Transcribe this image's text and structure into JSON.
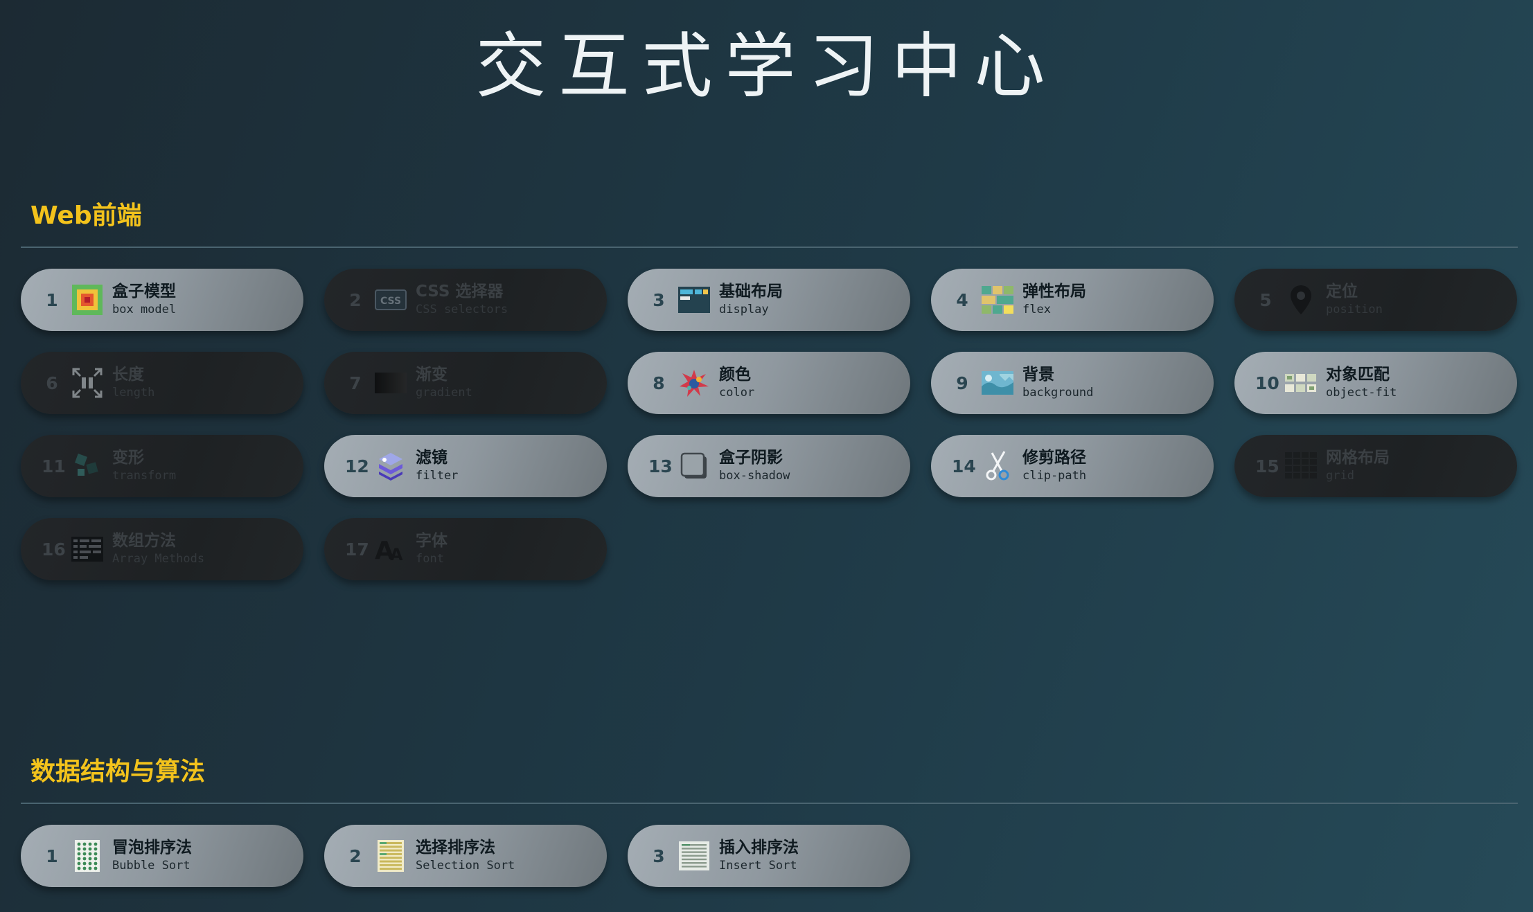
{
  "page": {
    "title": "交互式学习中心"
  },
  "sections": [
    {
      "title": "Web前端",
      "cards": [
        {
          "num": "1",
          "title": "盒子模型",
          "sub": "box model",
          "icon": "box-model-icon",
          "active": true
        },
        {
          "num": "2",
          "title": "CSS 选择器",
          "sub": "CSS selectors",
          "icon": "css-icon",
          "active": false
        },
        {
          "num": "3",
          "title": "基础布局",
          "sub": "display",
          "icon": "display-layout-icon",
          "active": true
        },
        {
          "num": "4",
          "title": "弹性布局",
          "sub": "flex",
          "icon": "flex-grid-icon",
          "active": true
        },
        {
          "num": "5",
          "title": "定位",
          "sub": "position",
          "icon": "location-pin-icon",
          "active": false
        },
        {
          "num": "6",
          "title": "长度",
          "sub": "length",
          "icon": "expand-arrows-icon",
          "active": false
        },
        {
          "num": "7",
          "title": "渐变",
          "sub": "gradient",
          "icon": "gradient-icon",
          "active": false
        },
        {
          "num": "8",
          "title": "颜色",
          "sub": "color",
          "icon": "color-splash-icon",
          "active": true
        },
        {
          "num": "9",
          "title": "背景",
          "sub": "background",
          "icon": "background-image-icon",
          "active": true
        },
        {
          "num": "10",
          "title": "对象匹配",
          "sub": "object-fit",
          "icon": "object-fit-icon",
          "active": true
        },
        {
          "num": "11",
          "title": "变形",
          "sub": "transform",
          "icon": "transform-icon",
          "active": false
        },
        {
          "num": "12",
          "title": "滤镜",
          "sub": "filter",
          "icon": "filter-layers-icon",
          "active": true
        },
        {
          "num": "13",
          "title": "盒子阴影",
          "sub": "box-shadow",
          "icon": "box-shadow-icon",
          "active": true
        },
        {
          "num": "14",
          "title": "修剪路径",
          "sub": "clip-path",
          "icon": "scissors-icon",
          "active": true
        },
        {
          "num": "15",
          "title": "网格布局",
          "sub": "grid",
          "icon": "grid-icon",
          "active": false
        },
        {
          "num": "16",
          "title": "数组方法",
          "sub": "Array Methods",
          "icon": "array-icon",
          "active": false
        },
        {
          "num": "17",
          "title": "字体",
          "sub": "font",
          "icon": "font-aa-icon",
          "active": false
        }
      ]
    },
    {
      "title": "数据结构与算法",
      "cards": [
        {
          "num": "1",
          "title": "冒泡排序法",
          "sub": "Bubble Sort",
          "icon": "bubble-sort-icon",
          "active": true
        },
        {
          "num": "2",
          "title": "选择排序法",
          "sub": "Selection Sort",
          "icon": "selection-sort-icon",
          "active": true
        },
        {
          "num": "3",
          "title": "插入排序法",
          "sub": "Insert Sort",
          "icon": "insert-sort-icon",
          "active": true
        }
      ]
    }
  ],
  "colors": {
    "section_title": "#f3c31c",
    "active_card": "#9aa3a9",
    "inactive_card": "#222527"
  }
}
